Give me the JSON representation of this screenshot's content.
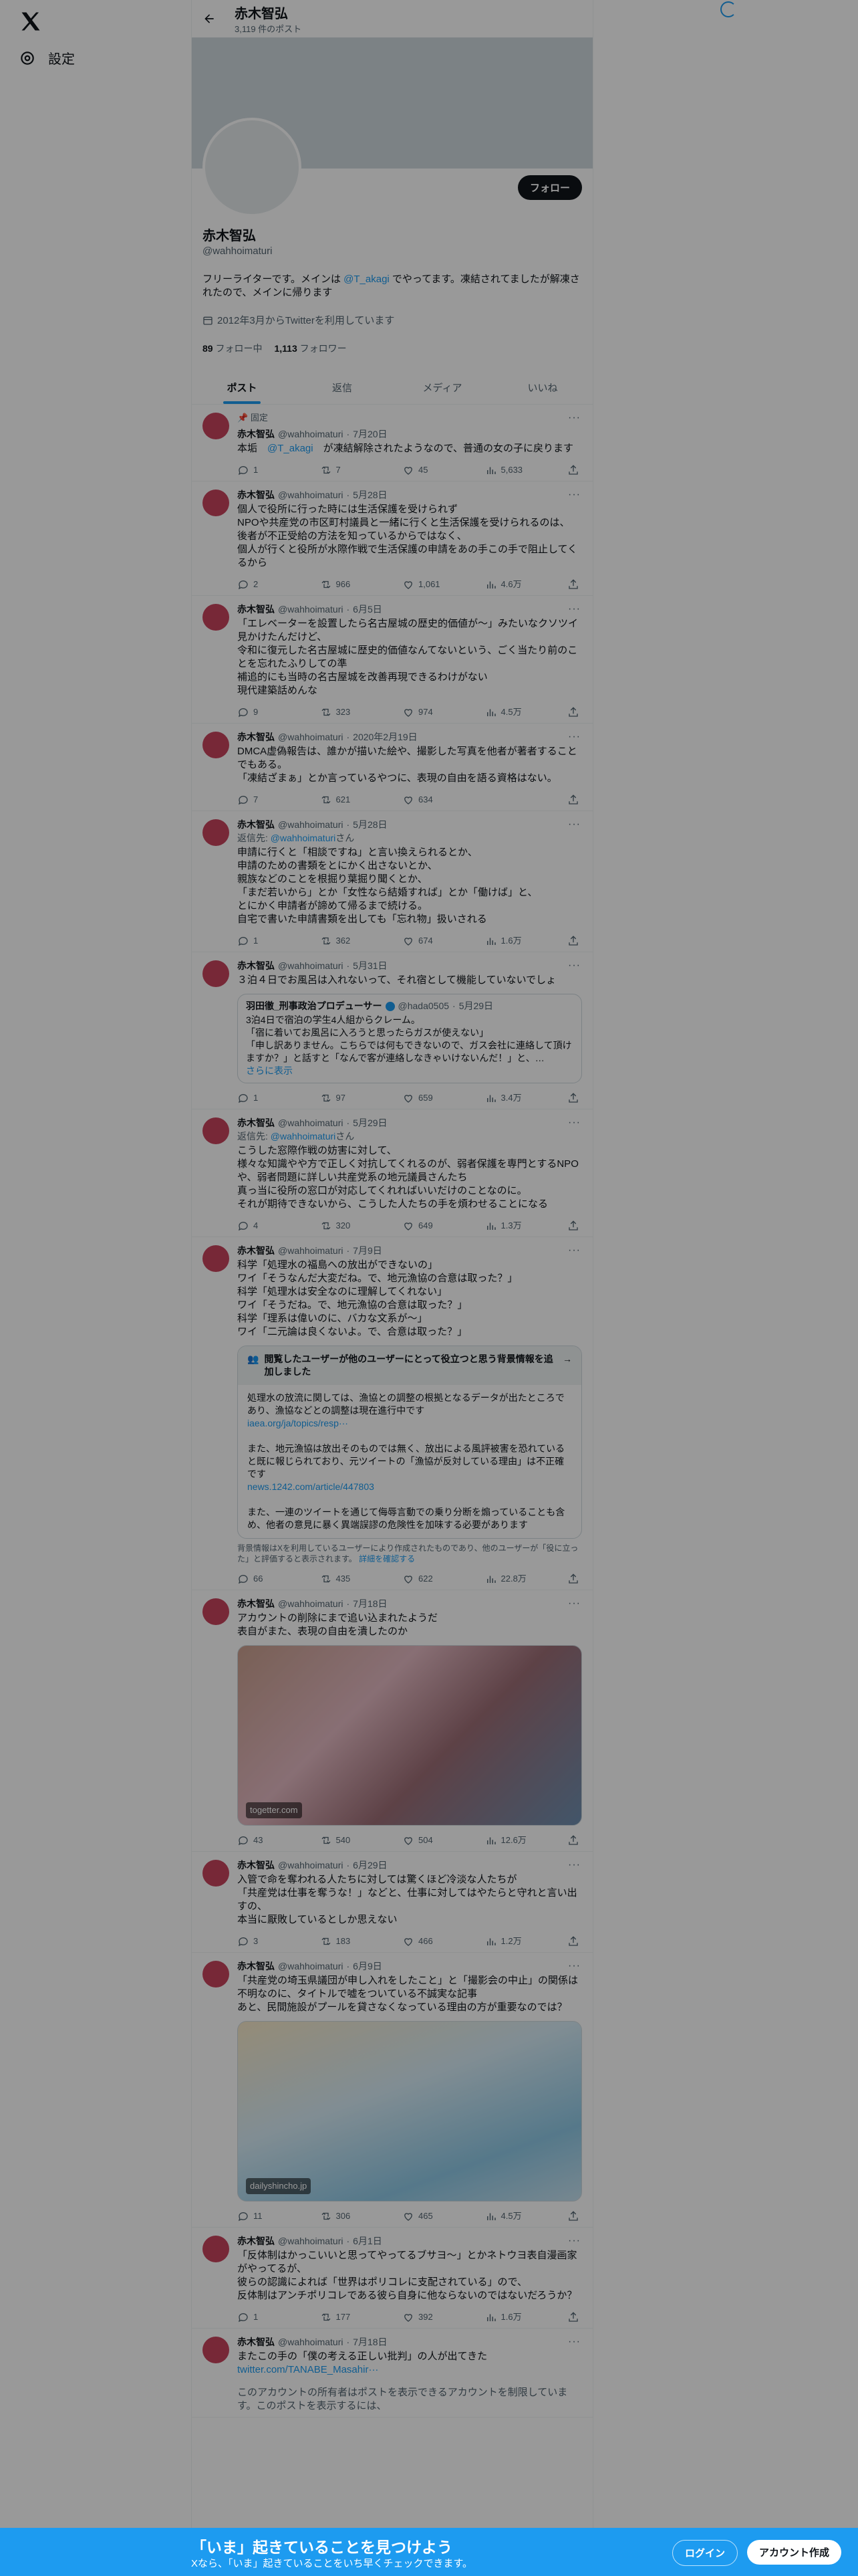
{
  "sidebar": {
    "settings_label": "設定"
  },
  "header": {
    "name": "赤木智弘",
    "post_count": "3,119 件のポスト"
  },
  "profile": {
    "follow_label": "フォロー",
    "name": "赤木智弘",
    "handle": "@wahhoimaturi",
    "bio_pre": "フリーライターです。メインは ",
    "bio_link": "@T_akagi",
    "bio_post": " でやってます。凍結されてましたが解凍されたので、メインに帰ります",
    "joined": "2012年3月からTwitterを利用しています",
    "following_count": "89",
    "following_label": "フォロー中",
    "followers_count": "1,113",
    "followers_label": "フォロワー"
  },
  "tabs": [
    "ポスト",
    "返信",
    "メディア",
    "いいね"
  ],
  "tweets": [
    {
      "pinned": "固定",
      "name": "赤木智弘",
      "handle": "@wahhoimaturi",
      "date": "7月20日",
      "body_pre": "本垢　",
      "body_link": "@T_akagi",
      "body_post": "　が凍結解除されたようなので、普通の女の子に戻ります",
      "replies": "1",
      "retweets": "7",
      "likes": "45",
      "views": "5,633"
    },
    {
      "name": "赤木智弘",
      "handle": "@wahhoimaturi",
      "date": "5月28日",
      "body": "個人で役所に行った時には生活保護を受けられず\nNPOや共産党の市区町村議員と一緒に行くと生活保護を受けられるのは、\n後者が不正受給の方法を知っているからではなく、\n個人が行くと役所が水際作戦で生活保護の申請をあの手この手で阻止してくるから",
      "replies": "2",
      "retweets": "966",
      "likes": "1,061",
      "views": "4.6万"
    },
    {
      "name": "赤木智弘",
      "handle": "@wahhoimaturi",
      "date": "6月5日",
      "body": "「エレベーターを設置したら名古屋城の歴史的価値が～」みたいなクソツイ見かけたんだけど、\n令和に復元した名古屋城に歴史的価値なんてないという、ごく当たり前のことを忘れたふりしての準\n補追的にも当時の名古屋城を改善再現できるわけがない\n現代建築話めんな",
      "replies": "9",
      "retweets": "323",
      "likes": "974",
      "views": "4.5万"
    },
    {
      "name": "赤木智弘",
      "handle": "@wahhoimaturi",
      "date": "2020年2月19日",
      "body": "DMCA虚偽報告は、誰かが描いた絵や、撮影した写真を他者が著者することでもある。\n「凍結ざまぁ」とか言っているやつに、表現の自由を語る資格はない。",
      "replies": "7",
      "retweets": "621",
      "likes": "634",
      "views": ""
    },
    {
      "name": "赤木智弘",
      "handle": "@wahhoimaturi",
      "date": "5月28日",
      "reply_prefix": "返信先: ",
      "reply_link": "@wahhoimaturi",
      "reply_suffix": "さん",
      "body": "申請に行くと「相談ですね」と言い換えられるとか、\n申請のための書類をとにかく出さないとか、\n親族などのことを根掘り葉掘り聞くとか、\n「まだ若いから」とか「女性なら結婚すれば」とか「働けば」と、\nとにかく申請者が諦めて帰るまで続ける。\n自宅で書いた申請書類を出しても「忘れ物」扱いされる",
      "replies": "1",
      "retweets": "362",
      "likes": "674",
      "views": "1.6万"
    },
    {
      "name": "赤木智弘",
      "handle": "@wahhoimaturi",
      "date": "5月31日",
      "body": "３泊４日でお風呂は入れないって、それ宿として機能していないでしょ",
      "quote": {
        "name": "羽田徹_刑事政治プロデューサー",
        "handle": "@hada0505",
        "date": "5月29日",
        "body": "3泊4日で宿泊の学生4人組からクレーム。\n「宿に着いてお風呂に入ろうと思ったらガスが使えない」\n「申し訳ありません。こちらでは何もできないので、ガス会社に連絡して頂けますか？」と話すと「なんで客が連絡しなきゃいけないんだ！」と、…",
        "more": "さらに表示"
      },
      "replies": "1",
      "retweets": "97",
      "likes": "659",
      "views": "3.4万"
    },
    {
      "name": "赤木智弘",
      "handle": "@wahhoimaturi",
      "date": "5月29日",
      "reply_prefix": "返信先: ",
      "reply_link": "@wahhoimaturi",
      "reply_suffix": "さん",
      "body": "こうした窓際作戦の妨害に対して、\n様々な知識やや方で正しく対抗してくれるのが、弱者保護を専門とするNPOや、弱者問題に詳しい共産党系の地元議員さんたち\n真っ当に役所の窓口が対応してくれればいいだけのことなのに。\nそれが期待できないから、こうした人たちの手を煩わせることになる",
      "replies": "4",
      "retweets": "320",
      "likes": "649",
      "views": "1.3万"
    },
    {
      "name": "赤木智弘",
      "handle": "@wahhoimaturi",
      "date": "7月9日",
      "body": "科学「処理水の福島への放出ができないの」\nワイ「そうなんだ大変だね。で、地元漁協の合意は取った？」\n科学「処理水は安全なのに理解してくれない」\nワイ「そうだね。で、地元漁協の合意は取った？」\n科学「理系は偉いのに、バカな文系が～」\nワイ「二元論は良くないよ。で、合意は取った？」",
      "note": {
        "title": "閲覧したユーザーが他のユーザーにとって役立つと思う背景情報を追加しました",
        "body": "処理水の放流に関しては、漁協との調整の根拠となるデータが出たところであり、漁協などとの調整は現在進行中です",
        "link1": "iaea.org/ja/topics/resp···",
        "body2": "また、地元漁協は放出そのものでは無く、放出による風評被害を恐れていると既に報じられており、元ツイートの「漁協が反対している理由」は不正確です",
        "link2": "news.1242.com/article/447803",
        "body3": "また、一連のツイートを通じて侮辱言動での乗り分断を煽っていることも含め、他者の意見に暴く異端誤謬の危険性を加味する必要があります",
        "foot": "背景情報はXを利用しているユーザーにより作成されたものであり、他のユーザーが「役に立った」と評価すると表示されます。",
        "foot_link": "詳細を確認する"
      },
      "replies": "66",
      "retweets": "435",
      "likes": "622",
      "views": "22.8万"
    },
    {
      "name": "赤木智弘",
      "handle": "@wahhoimaturi",
      "date": "7月18日",
      "body": "アカウントの削除にまで追い込まれたようだ\n表自がまた、表現の自由を潰したのか",
      "media_src": "togetter.com",
      "replies": "43",
      "retweets": "540",
      "likes": "504",
      "views": "12.6万"
    },
    {
      "name": "赤木智弘",
      "handle": "@wahhoimaturi",
      "date": "6月29日",
      "body": "入管で命を奪われる人たちに対しては驚くほど冷淡な人たちが\n「共産党は仕事を奪うな！」などと、仕事に対してはやたらと守れと言い出すの、\n本当に厭敗しているとしか思えない",
      "replies": "3",
      "retweets": "183",
      "likes": "466",
      "views": "1.2万"
    },
    {
      "name": "赤木智弘",
      "handle": "@wahhoimaturi",
      "date": "6月9日",
      "body": "「共産党の埼玉県議団が申し入れをしたこと」と「撮影会の中止」の関係は不明なのに、タイトルで嘘をついている不誠実な記事\nあと、民間施設がプールを貸さなくなっている理由の方が重要なのでは？",
      "media_src": "dailyshincho.jp",
      "replies": "11",
      "retweets": "306",
      "likes": "465",
      "views": "4.5万"
    },
    {
      "name": "赤木智弘",
      "handle": "@wahhoimaturi",
      "date": "6月1日",
      "body": "「反体制はかっこいいと思ってやってるブサヨ～」とかネトウヨ表自漫画家がやってるが、\n彼らの認識によれば「世界はポリコレに支配されている」ので、\n反体制はアンチポリコレである彼ら自身に他ならないのではないだろうか？",
      "replies": "1",
      "retweets": "177",
      "likes": "392",
      "views": "1.6万"
    },
    {
      "name": "赤木智弘",
      "handle": "@wahhoimaturi",
      "date": "7月18日",
      "body": "またこの手の「僕の考える正しい批判」の人が出てきた",
      "link": "twitter.com/TANABE_Masahir···",
      "restricted": "このアカウントの所有者はポストを表示できるアカウントを制限しています。このポストを表示するには、"
    }
  ],
  "bottom": {
    "title": "「いま」起きていることを見つけよう",
    "subtitle": "Xなら、「いま」起きていることをいち早くチェックできます。",
    "login": "ログイン",
    "signup": "アカウント作成"
  }
}
